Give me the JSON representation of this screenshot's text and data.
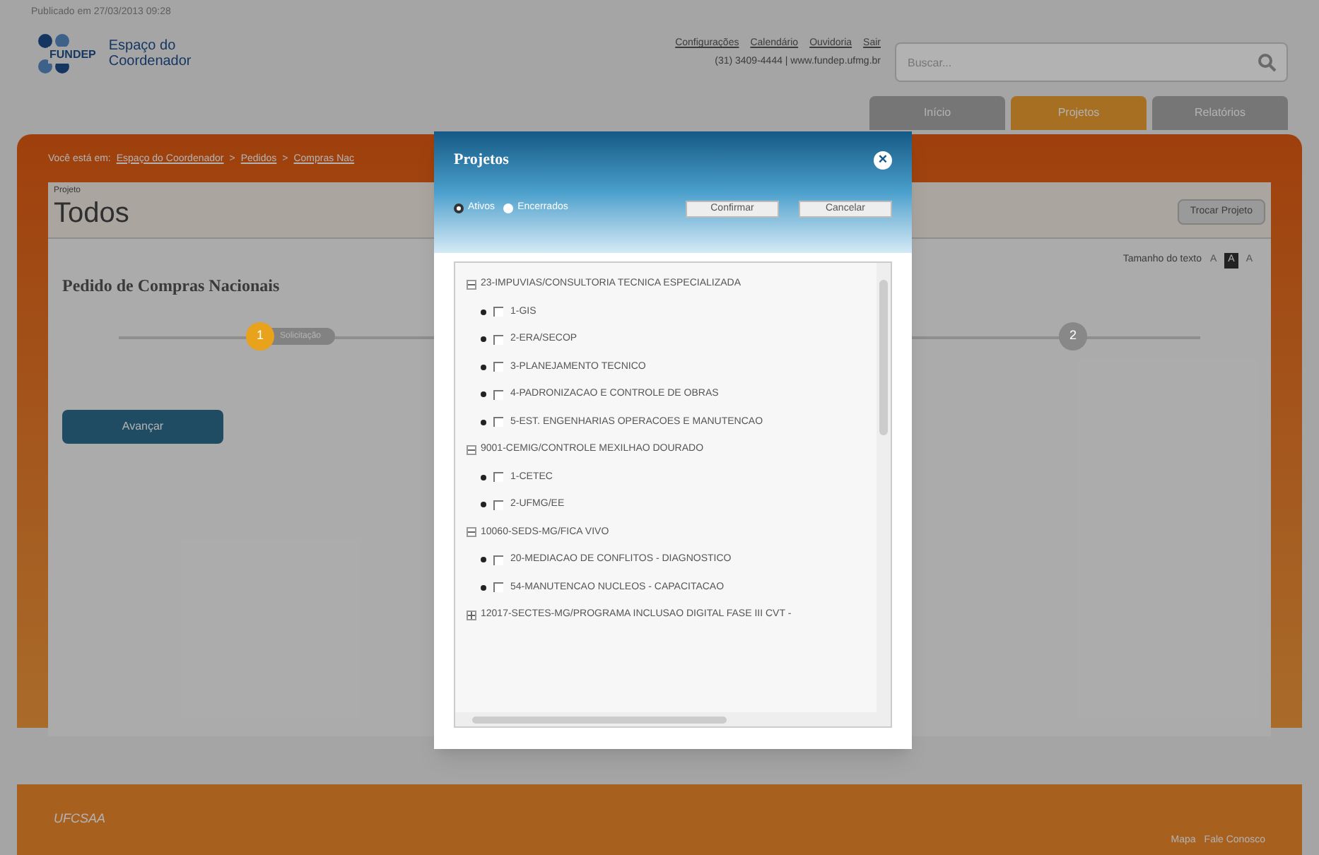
{
  "published": "Publicado em 27/03/2013 09:28",
  "logo": {
    "brand": "FUNDEP",
    "title": "Espaço do Coordenador"
  },
  "top_links": [
    "Configurações",
    "Calendário",
    "Ouvidoria",
    "Sair"
  ],
  "phone": "(31) 3409-4444 | www.fundep.ufmg.br",
  "search": {
    "placeholder": "Buscar..."
  },
  "nav_tabs": [
    {
      "label": "Início",
      "selected": false
    },
    {
      "label": "Projetos",
      "selected": true
    },
    {
      "label": "Relatórios",
      "selected": false
    }
  ],
  "breadcrumb": {
    "prefix": "Você está em:",
    "links": [
      "Espaço do Coordenador",
      "Pedidos",
      "Compras Nac"
    ],
    "separator": ">"
  },
  "project": {
    "label": "Projeto",
    "value": "Todos",
    "change_button": "Trocar Projeto"
  },
  "text_size": {
    "label": "Tamanho do texto",
    "options": [
      {
        "label": "A",
        "selected": false
      },
      {
        "label": "A",
        "selected": true
      },
      {
        "label": "A",
        "selected": false
      }
    ]
  },
  "page_title": "Pedido de Compras Nacionais",
  "steps": [
    {
      "number": "1",
      "label": "Solicitação",
      "active": true
    },
    {
      "number": "2",
      "active": false
    }
  ],
  "action_button": "Avançar",
  "footer": {
    "logo": "UFCSAA",
    "links": [
      "Mapa",
      "Fale Conosco"
    ]
  },
  "modal": {
    "title": "Projetos",
    "close": "×",
    "filters": [
      {
        "label": "Ativos",
        "selected": true
      },
      {
        "label": "Encerrados",
        "selected": false
      }
    ],
    "buttons": [
      "Confirmar",
      "Cancelar"
    ],
    "tree": [
      {
        "label": "23-IMPUVIAS/CONSULTORIA TECNICA ESPECIALIZADA",
        "expanded": true,
        "children": [
          {
            "label": "1-GIS",
            "checked": false
          },
          {
            "label": "2-ERA/SECOP",
            "checked": false
          },
          {
            "label": "3-PLANEJAMENTO TECNICO",
            "checked": false
          },
          {
            "label": "4-PADRONIZACAO E CONTROLE DE OBRAS",
            "checked": false
          },
          {
            "label": "5-EST. ENGENHARIAS OPERACOES E MANUTENCAO",
            "checked": false
          }
        ]
      },
      {
        "label": "9001-CEMIG/CONTROLE MEXILHAO DOURADO",
        "expanded": true,
        "children": [
          {
            "label": "1-CETEC",
            "checked": false
          },
          {
            "label": "2-UFMG/EE",
            "checked": false
          }
        ]
      },
      {
        "label": "10060-SEDS-MG/FICA VIVO",
        "expanded": true,
        "children": [
          {
            "label": "20-MEDIACAO DE CONFLITOS - DIAGNOSTICO",
            "checked": false
          },
          {
            "label": "54-MANUTENCAO NUCLEOS - CAPACITACAO",
            "checked": false
          }
        ]
      },
      {
        "label": "12017-SECTES-MG/PROGRAMA INCLUSAO DIGITAL FASE III CVT -",
        "expanded": false
      }
    ]
  }
}
